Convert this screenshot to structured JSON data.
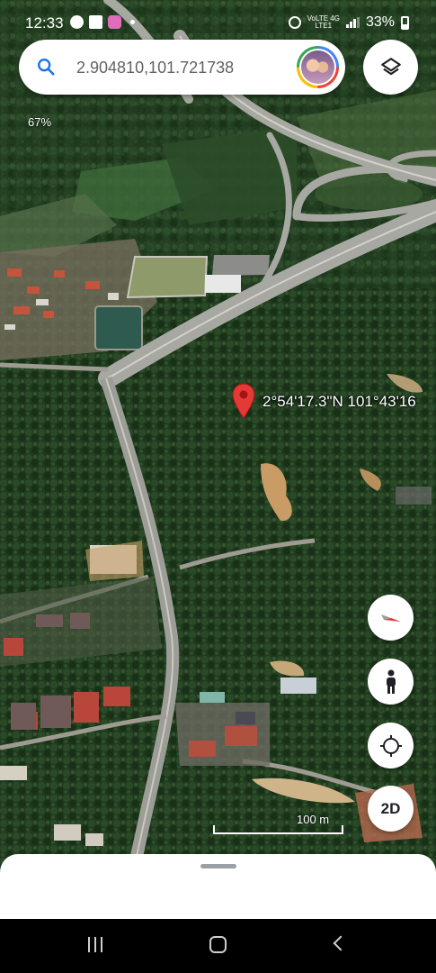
{
  "status_bar": {
    "time": "12:33",
    "network_top": "VoLTE 4G",
    "network_bottom": "LTE1",
    "battery": "33%",
    "left_icons": [
      "whatsapp-icon",
      "gallery-icon",
      "cat-app-icon",
      "dot-icon"
    ],
    "right_icons": [
      "alarm-icon",
      "volte-icon",
      "signal-icon",
      "battery-icon"
    ]
  },
  "search": {
    "value": "2.904810,101.721738",
    "icon": "search-icon"
  },
  "map": {
    "zoom_text": "67%",
    "coordinates_label": "2°54'17.3\"N 101°43'16",
    "scale_label": "100 m",
    "pin_color": "#e53935"
  },
  "controls": {
    "compass": "compass-icon",
    "street_view": "pegman-icon",
    "my_location": "my-location-icon",
    "view_mode_label": "2D",
    "layers": "layers-icon"
  },
  "colors": {
    "accent_blue": "#1a73e8",
    "forest": "#1f3a1f",
    "road": "#b9b9b4"
  }
}
